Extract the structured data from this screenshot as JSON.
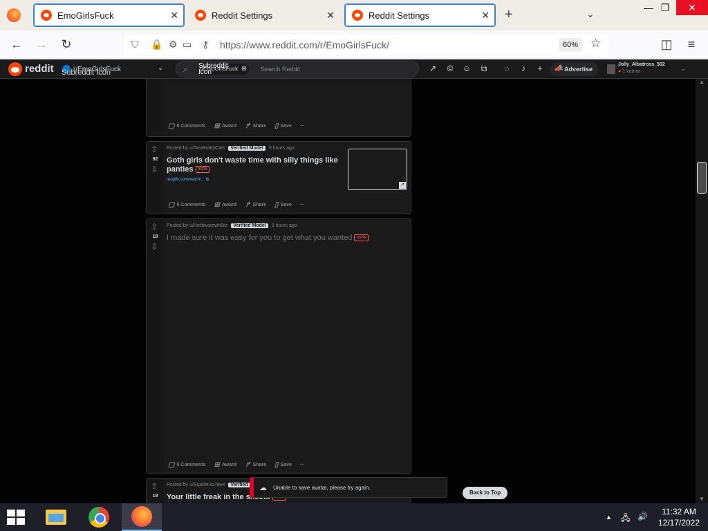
{
  "browser": {
    "tabs": [
      {
        "title": "EmoGirlsFuck",
        "active": true
      },
      {
        "title": "Reddit Settings",
        "active": false
      },
      {
        "title": "Reddit Settings",
        "active": true
      }
    ],
    "new_tab_icon": "+",
    "tab_list_icon": "⌄",
    "window_controls": {
      "minimize": "—",
      "maximize": "❐",
      "close": "✕"
    },
    "url": "https://www.reddit.com/r/EmoGirlsFuck/",
    "zoom": "60%"
  },
  "reddit_header": {
    "brand": "reddit",
    "community_label": "r/EmoGirlsFuck",
    "community_alt": "Subreddit Icon",
    "search_chip": "r/EmoGirlsFuck",
    "search_chip_alt": "Subreddit Icon",
    "search_placeholder": "Search Reddit",
    "advertise_label": "Advertise",
    "username": "Jolly_Albatross_502",
    "karma": "1 karma"
  },
  "posts": [
    {
      "actions": {
        "comments": "8 Comments",
        "award": "Award",
        "share": "Share",
        "save": "Save",
        "more": "···"
      }
    },
    {
      "votes": "92",
      "posted_by": "Posted by u/TwoBrattyCats",
      "flair": "Verified Model",
      "time": "9 hours ago",
      "title": "Goth girls don't waste time with silly things like panties",
      "nsfw": "nsfw",
      "link": "redgifs.com/watch/...",
      "actions": {
        "comments": "5 Comments",
        "award": "Award",
        "share": "Share",
        "save": "Save",
        "more": "···"
      }
    },
    {
      "votes": "18",
      "posted_by": "Posted by u/Herbivorewh0re",
      "flair": "Verified Model",
      "time": "3 hours ago",
      "title": "I made sure it was easy for you to get what you wanted",
      "nsfw": "nsfw",
      "actions": {
        "comments": "5 Comments",
        "award": "Award",
        "share": "Share",
        "save": "Save",
        "more": "···"
      }
    },
    {
      "votes": "19",
      "posted_by": "Posted by u/Scarlet-is-here",
      "flair": "Verified",
      "title": "Your little freak in the sheets",
      "nsfw": "nsfw"
    }
  ],
  "toast": {
    "message": "Unable to save avatar, please try again."
  },
  "back_to_top": "Back to Top",
  "taskbar": {
    "time": "11:32 AM",
    "date": "12/17/2022"
  }
}
